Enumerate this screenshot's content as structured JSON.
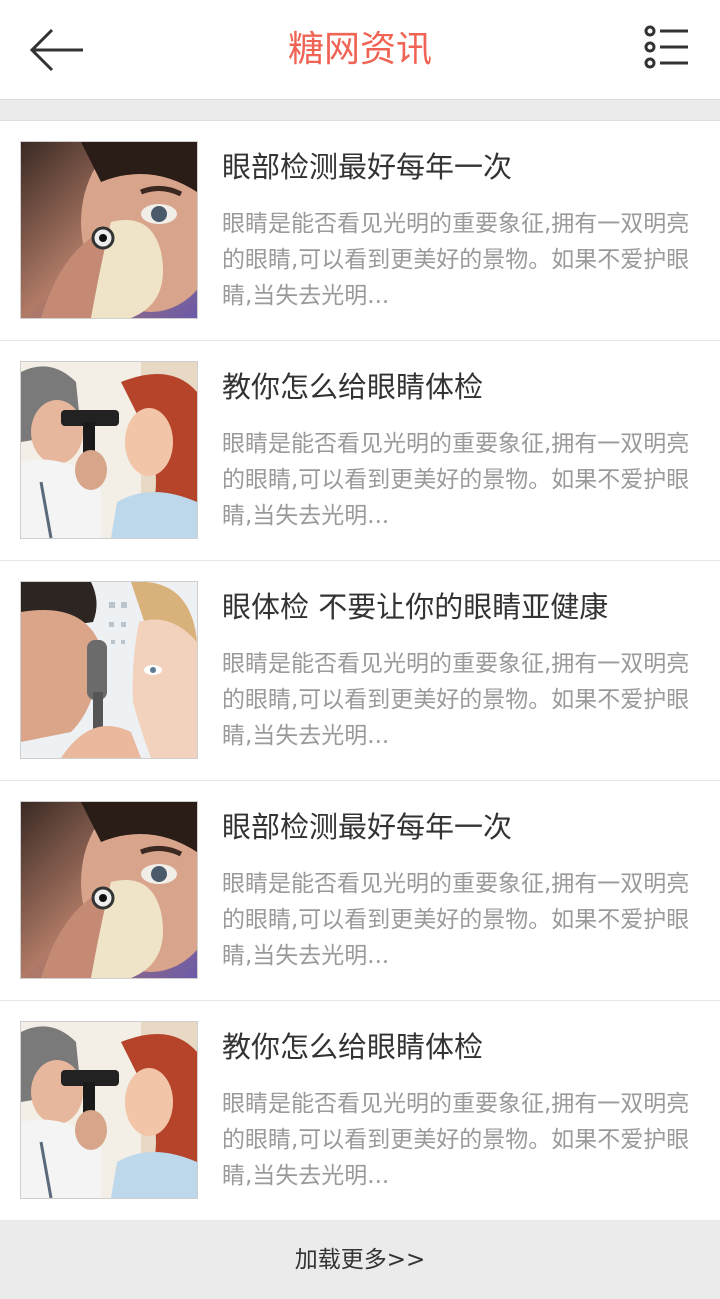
{
  "header": {
    "title": "糖网资讯",
    "back_icon": "arrow-left-icon",
    "menu_icon": "list-menu-icon",
    "title_color": "#f06456"
  },
  "articles": [
    {
      "title": "眼部检测最好每年一次",
      "summary": "眼睛是能否看见光明的重要象征,拥有一双明亮的眼睛,可以看到更美好的景物。如果不爱护眼睛,当失去光明...",
      "image": "eye-exam-closeup-photo"
    },
    {
      "title": "教你怎么给眼睛体检",
      "summary": "眼睛是能否看见光明的重要象征,拥有一双明亮的眼睛,可以看到更美好的景物。如果不爱护眼睛,当失去光明...",
      "image": "doctor-examining-woman-eye-photo"
    },
    {
      "title": "眼体检 不要让你的眼睛亚健康",
      "summary": "眼睛是能否看见光明的重要象征,拥有一双明亮的眼睛,可以看到更美好的景物。如果不爱护眼睛,当失去光明...",
      "image": "ophthalmoscope-exam-photo"
    },
    {
      "title": "眼部检测最好每年一次",
      "summary": "眼睛是能否看见光明的重要象征,拥有一双明亮的眼睛,可以看到更美好的景物。如果不爱护眼睛,当失去光明...",
      "image": "eye-exam-closeup-photo"
    },
    {
      "title": "教你怎么给眼睛体检",
      "summary": "眼睛是能否看见光明的重要象征,拥有一双明亮的眼睛,可以看到更美好的景物。如果不爱护眼睛,当失去光明...",
      "image": "doctor-examining-woman-eye-photo"
    }
  ],
  "load_more": "加载更多>>"
}
